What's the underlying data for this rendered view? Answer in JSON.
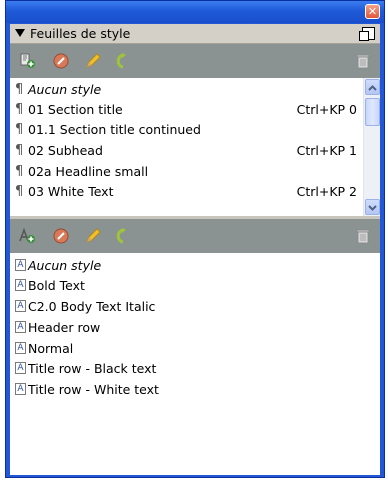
{
  "panel": {
    "title": "Feuilles de style"
  },
  "paragraph_styles": [
    {
      "name": "Aucun style",
      "shortcut": "",
      "italic": true
    },
    {
      "name": "01 Section title",
      "shortcut": "Ctrl+KP 0"
    },
    {
      "name": "01.1 Section title continued",
      "shortcut": ""
    },
    {
      "name": "02 Subhead",
      "shortcut": "Ctrl+KP 1"
    },
    {
      "name": "02a Headline small",
      "shortcut": ""
    },
    {
      "name": "03 White Text",
      "shortcut": "Ctrl+KP 2"
    }
  ],
  "character_styles": [
    {
      "name": "Aucun style",
      "italic": true
    },
    {
      "name": "Bold Text"
    },
    {
      "name": "C2.0 Body Text Italic"
    },
    {
      "name": "Header row"
    },
    {
      "name": "Normal"
    },
    {
      "name": "Title row - Black text"
    },
    {
      "name": "Title row - White text"
    }
  ],
  "glyphs": {
    "paragraph": "¶",
    "character": "A",
    "close": "✕"
  },
  "colors": {
    "titlebar": "#2258d6",
    "toolbar": "#8a9292",
    "add_icon": "#3c8f3c",
    "edit_icon": "#f0c030",
    "delete_icon": "#c8c8c8"
  },
  "icons": [
    "new-paragraph-style-icon",
    "edit-style-icon",
    "pencil-icon",
    "undo-style-icon",
    "trash-icon",
    "new-character-style-icon"
  ]
}
